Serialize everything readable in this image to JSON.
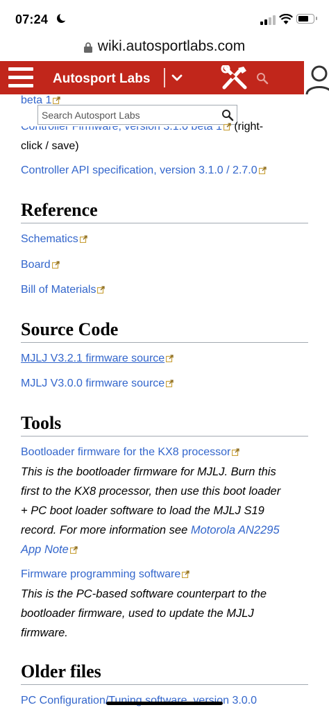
{
  "status": {
    "time": "07:24"
  },
  "browser": {
    "url": "wiki.autosportlabs.com"
  },
  "header": {
    "brand": "Autosport Labs"
  },
  "search": {
    "placeholder": "Search Autosport Labs"
  },
  "top_links": {
    "beta1_fragment": "beta 1",
    "controller_firmware": "Controller Firmware, version 3.1.0 beta 1",
    "controller_firmware_suffix1": " (right-",
    "controller_firmware_suffix2": "click / save)",
    "api_spec": "Controller API specification, version 3.1.0 / 2.7.0"
  },
  "reference": {
    "heading": "Reference",
    "items": [
      "Schematics",
      "Board",
      "Bill of Materials"
    ]
  },
  "source_code": {
    "heading": "Source Code",
    "items": [
      "MJLJ V3.2.1 firmware source",
      "MJLJ V3.0.0 firmware source"
    ]
  },
  "tools": {
    "heading": "Tools",
    "bootloader_link": "Bootloader firmware for the KX8 processor",
    "bootloader_desc": [
      "This is the bootloader firmware for MJLJ. Burn this",
      "first to the KX8 processor, then use this boot loader",
      "+ PC boot loader software to load the MJLJ S19",
      "record. For more information see "
    ],
    "motorola_link_a": "Motorola AN2295",
    "motorola_link_b": "App Note",
    "programming_link": "Firmware programming software",
    "programming_desc": [
      "This is the PC-based software counterpart to the",
      "bootloader firmware, used to update the MJLJ",
      "firmware."
    ]
  },
  "older_files": {
    "heading": "Older files",
    "first_item": "PC Configuration/Tuning software, version 3.0.0"
  },
  "colors": {
    "header_red": "#c1261b",
    "link_blue": "#3366cc"
  }
}
